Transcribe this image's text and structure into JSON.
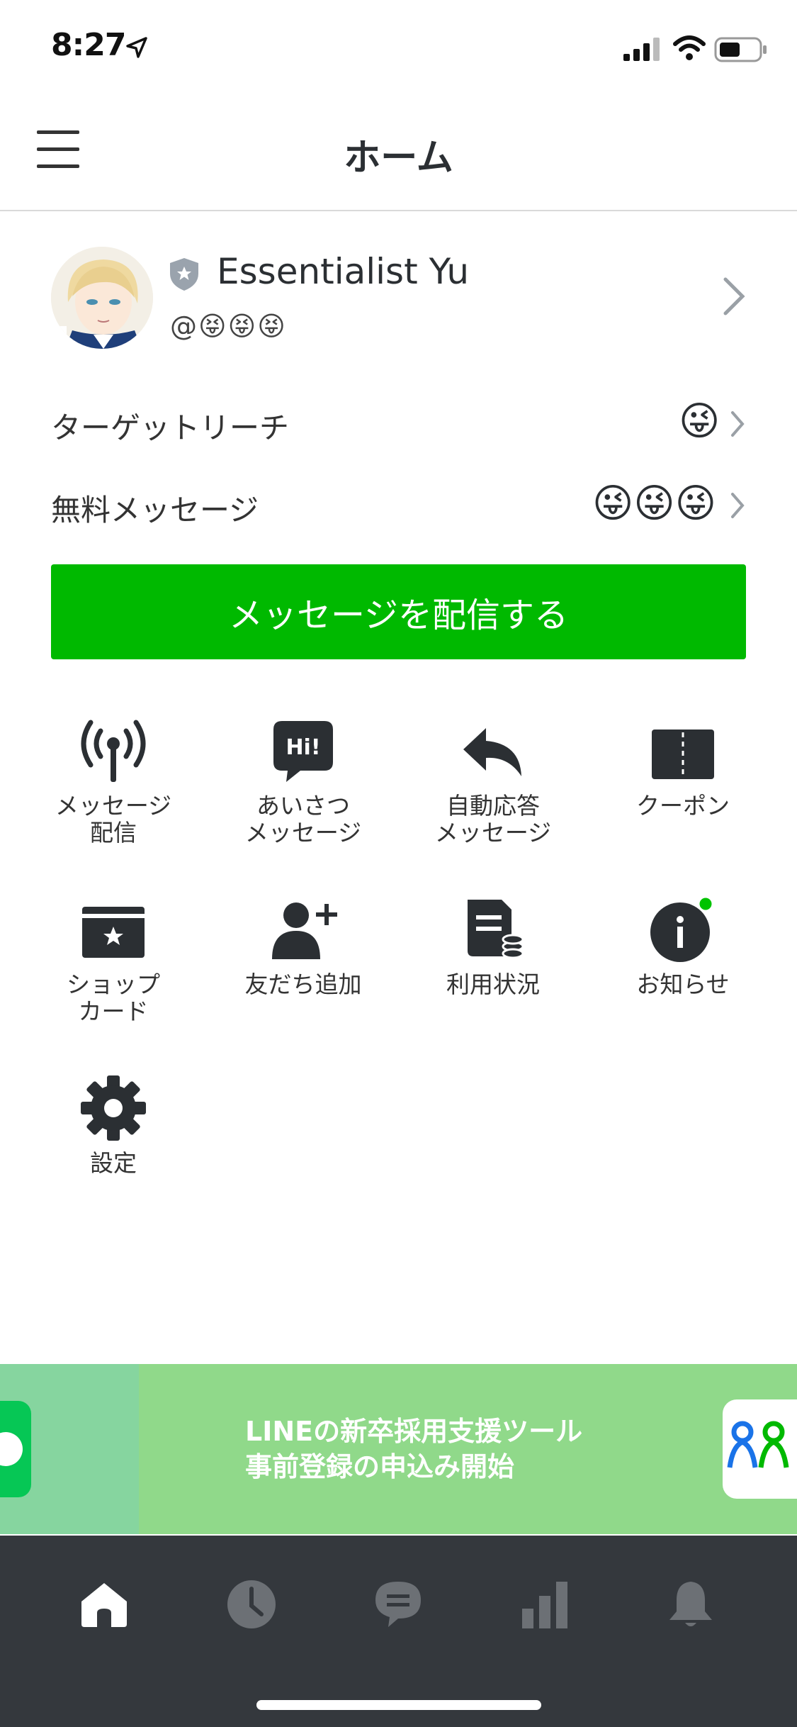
{
  "status_bar": {
    "time": "8:27"
  },
  "header": {
    "title": "ホーム"
  },
  "profile": {
    "name": "Essentialist Yu",
    "id_prefix": "@",
    "id_emojis": [
      "😝",
      "😝",
      "😝"
    ]
  },
  "rows": [
    {
      "label": "ターゲットリーチ",
      "value": "😜"
    },
    {
      "label": "無料メッセージ",
      "value": "😜😜😜"
    }
  ],
  "cta": {
    "label": "メッセージを配信する"
  },
  "features": [
    {
      "label": "メッセージ\n配信",
      "icon": "broadcast-icon"
    },
    {
      "label": "あいさつ\nメッセージ",
      "icon": "hi-bubble-icon"
    },
    {
      "label": "自動応答\nメッセージ",
      "icon": "reply-arrow-icon"
    },
    {
      "label": "クーポン",
      "icon": "coupon-icon"
    },
    {
      "label": "ショップ\nカード",
      "icon": "shop-card-icon"
    },
    {
      "label": "友だち追加",
      "icon": "add-friend-icon"
    },
    {
      "label": "利用状況",
      "icon": "usage-icon"
    },
    {
      "label": "お知らせ",
      "icon": "info-icon"
    },
    {
      "label": "設定",
      "icon": "gear-icon"
    }
  ],
  "banner": {
    "line1": "LINEの新卒採用支援ツール",
    "line2": "事前登録の申込み開始"
  },
  "tabs": [
    {
      "name": "home",
      "icon": "home-icon",
      "active": true
    },
    {
      "name": "history",
      "icon": "clock-icon",
      "active": false
    },
    {
      "name": "chat",
      "icon": "chat-icon",
      "active": false
    },
    {
      "name": "stats",
      "icon": "bar-chart-icon",
      "active": false
    },
    {
      "name": "notifications",
      "icon": "bell-icon",
      "active": false
    }
  ],
  "colors": {
    "accent_green": "#00b900",
    "tab_bar": "#34383d",
    "banner": "#90d98a",
    "notification_dot": "#00c300"
  }
}
